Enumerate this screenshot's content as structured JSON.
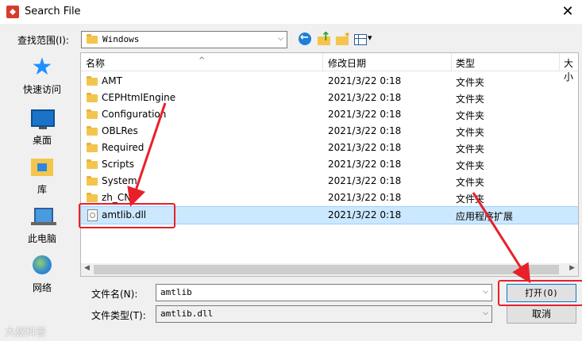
{
  "window": {
    "title": "Search File"
  },
  "toolbar": {
    "look_in_label": "查找范围(I):",
    "look_in_value": "Windows",
    "icons": [
      "back-icon",
      "up-folder-icon",
      "new-folder-icon",
      "view-menu-icon"
    ]
  },
  "places": [
    {
      "label": "快速访问",
      "icon": "star-icon"
    },
    {
      "label": "桌面",
      "icon": "desktop-icon"
    },
    {
      "label": "库",
      "icon": "library-icon"
    },
    {
      "label": "此电脑",
      "icon": "pc-icon"
    },
    {
      "label": "网络",
      "icon": "network-icon"
    }
  ],
  "list": {
    "columns": {
      "name": "名称",
      "date": "修改日期",
      "type": "类型",
      "size": "大小"
    },
    "rows": [
      {
        "name": "AMT",
        "date": "2021/3/22 0:18",
        "type": "文件夹",
        "icon": "folder-icon"
      },
      {
        "name": "CEPHtmlEngine",
        "date": "2021/3/22 0:18",
        "type": "文件夹",
        "icon": "folder-icon"
      },
      {
        "name": "Configuration",
        "date": "2021/3/22 0:18",
        "type": "文件夹",
        "icon": "folder-icon"
      },
      {
        "name": "OBLRes",
        "date": "2021/3/22 0:18",
        "type": "文件夹",
        "icon": "folder-icon"
      },
      {
        "name": "Required",
        "date": "2021/3/22 0:18",
        "type": "文件夹",
        "icon": "folder-icon"
      },
      {
        "name": "Scripts",
        "date": "2021/3/22 0:18",
        "type": "文件夹",
        "icon": "folder-icon"
      },
      {
        "name": "System",
        "date": "2021/3/22 0:18",
        "type": "文件夹",
        "icon": "folder-icon"
      },
      {
        "name": "zh_CN",
        "date": "2021/3/22 0:18",
        "type": "文件夹",
        "icon": "folder-icon"
      },
      {
        "name": "amtlib.dll",
        "date": "2021/3/22 0:18",
        "type": "应用程序扩展",
        "icon": "dll-file-icon",
        "selected": true
      }
    ]
  },
  "footer": {
    "filename_label": "文件名(N):",
    "filename_value": "amtlib",
    "filetype_label": "文件类型(T):",
    "filetype_value": "amtlib.dll",
    "open_label": "打开(O)",
    "cancel_label": "取消"
  },
  "annotation_color": "#e8202a",
  "watermark": "大叔科普"
}
